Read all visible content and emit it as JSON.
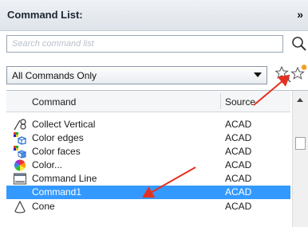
{
  "panel": {
    "title": "Command List:",
    "collapse_glyph": "»"
  },
  "search": {
    "placeholder": "Search command list",
    "value": "",
    "icon": "search-icon"
  },
  "filter": {
    "selected": "All Commands Only"
  },
  "toolbar": {
    "find_icon": "find-command-icon",
    "new_icon": "new-command-icon"
  },
  "list": {
    "columns": {
      "command": "Command",
      "source": "Source"
    },
    "rows": [
      {
        "name": "Collect Vertical",
        "source": "ACAD",
        "icon": "collect-vertical-icon"
      },
      {
        "name": "Color edges",
        "source": "ACAD",
        "icon": "color-edges-icon"
      },
      {
        "name": "Color faces",
        "source": "ACAD",
        "icon": "color-faces-icon"
      },
      {
        "name": "Color...",
        "source": "ACAD",
        "icon": "color-wheel-icon"
      },
      {
        "name": "Command Line",
        "source": "ACAD",
        "icon": "command-line-icon"
      },
      {
        "name": "Command1",
        "source": "ACAD",
        "icon": "none",
        "selected": true
      },
      {
        "name": "Cone",
        "source": "ACAD",
        "icon": "cone-icon"
      }
    ]
  },
  "colors": {
    "selection": "#3399ff",
    "annotation_arrow": "#e53020"
  }
}
